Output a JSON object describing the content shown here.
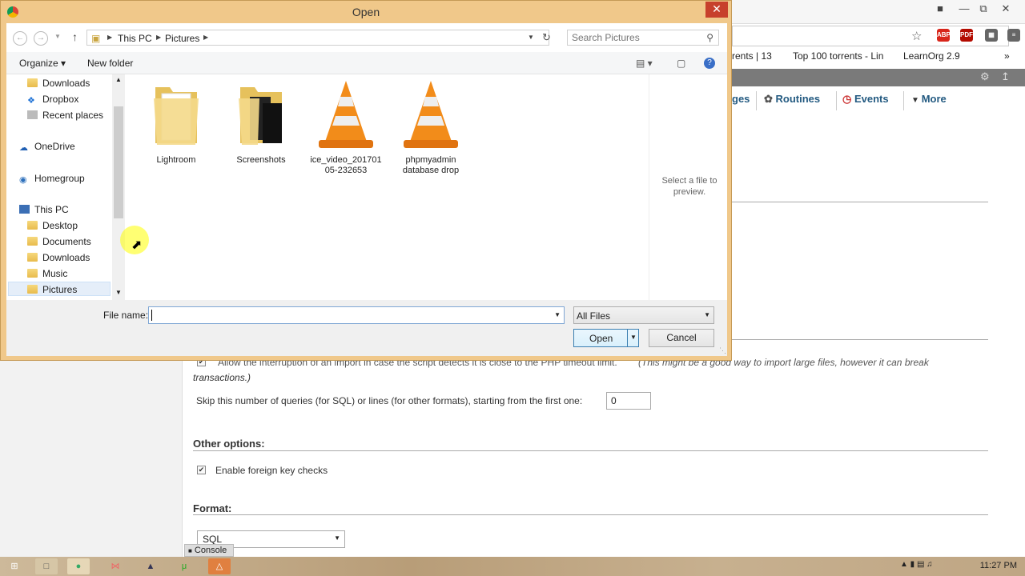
{
  "dialog": {
    "title": "Open",
    "breadcrumb": [
      "This PC",
      "Pictures"
    ],
    "search_placeholder": "Search Pictures",
    "organize_label": "Organize ▾",
    "new_folder_label": "New folder",
    "nav_items": [
      {
        "label": "Downloads",
        "icon": "folder-icon"
      },
      {
        "label": "Dropbox",
        "icon": "dropbox-icon"
      },
      {
        "label": "Recent places",
        "icon": "recent-places-icon"
      },
      {
        "label": "OneDrive",
        "icon": "onedrive-icon"
      },
      {
        "label": "Homegroup",
        "icon": "homegroup-icon"
      },
      {
        "label": "This PC",
        "icon": "computer-icon"
      },
      {
        "label": "Desktop",
        "icon": "folder-icon"
      },
      {
        "label": "Documents",
        "icon": "folder-icon"
      },
      {
        "label": "Downloads",
        "icon": "folder-icon"
      },
      {
        "label": "Music",
        "icon": "folder-icon"
      },
      {
        "label": "Pictures",
        "icon": "folder-icon",
        "selected": true
      }
    ],
    "files": [
      {
        "name": "Lightroom",
        "icon": "folder-icon"
      },
      {
        "name": "Screenshots",
        "icon": "folder-icon"
      },
      {
        "name": "ice_video_20170105-232653",
        "name_lines": [
          "ice_video_201701",
          "05-232653"
        ],
        "icon": "vlc-icon"
      },
      {
        "name": "phpmyadmin database drop",
        "name_lines": [
          "phpmyadmin",
          "database drop"
        ],
        "icon": "vlc-icon"
      }
    ],
    "preview_text": "Select a file to preview.",
    "file_name_label": "File name:",
    "file_name_value": "",
    "file_type_filter": "All Files",
    "open_label": "Open",
    "cancel_label": "Cancel"
  },
  "browser": {
    "bookmarks": [
      "rents | 13",
      "Top 100 torrents - Lin",
      "LearnOrg 2.9"
    ],
    "extensions": [
      "ABP",
      "PDF"
    ],
    "pma_tabs": [
      "ges",
      "Routines",
      "Events",
      "More"
    ]
  },
  "import_page": {
    "interrupt_text": "Allow the interruption of an import in case the script detects it is close to the PHP timeout limit.",
    "interrupt_note": "(This might be a good way to import large files, however it can break",
    "interrupt_note_cont": "transactions.)",
    "skip_label": "Skip this number of queries (for SQL) or lines (for other formats), starting from the first one:",
    "skip_value": "0",
    "other_options_heading": "Other options:",
    "foreign_key_label": "Enable foreign key checks",
    "format_heading": "Format:",
    "format_value": "SQL",
    "console_label": "Console"
  },
  "taskbar": {
    "clock": "11:27 PM"
  },
  "colors": {
    "dialog_frame": "#f0c88a",
    "close_button": "#c7402c",
    "pma_link": "#235a81"
  }
}
